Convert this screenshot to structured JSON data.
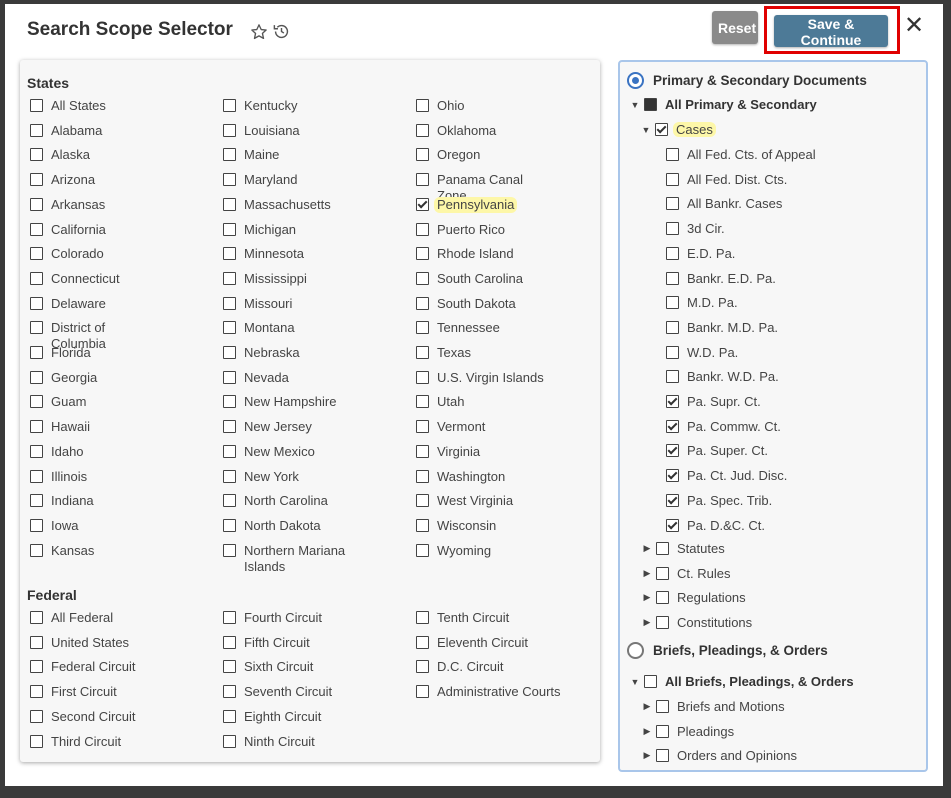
{
  "header": {
    "title": "Search Scope Selector",
    "star_icon": "star-icon",
    "history_icon": "history-icon",
    "reset_label": "Reset",
    "save_label": "Save & Continue",
    "close_label": "✕"
  },
  "states": {
    "heading": "States",
    "columns": [
      [
        {
          "label": "All States",
          "checked": false
        },
        {
          "label": "Alabama",
          "checked": false
        },
        {
          "label": "Alaska",
          "checked": false
        },
        {
          "label": "Arizona",
          "checked": false
        },
        {
          "label": "Arkansas",
          "checked": false
        },
        {
          "label": "California",
          "checked": false
        },
        {
          "label": "Colorado",
          "checked": false
        },
        {
          "label": "Connecticut",
          "checked": false
        },
        {
          "label": "Delaware",
          "checked": false
        },
        {
          "label": "District of Columbia",
          "checked": false
        },
        {
          "label": "Florida",
          "checked": false
        },
        {
          "label": "Georgia",
          "checked": false
        },
        {
          "label": "Guam",
          "checked": false
        },
        {
          "label": "Hawaii",
          "checked": false
        },
        {
          "label": "Idaho",
          "checked": false
        },
        {
          "label": "Illinois",
          "checked": false
        },
        {
          "label": "Indiana",
          "checked": false
        },
        {
          "label": "Iowa",
          "checked": false
        },
        {
          "label": "Kansas",
          "checked": false
        }
      ],
      [
        {
          "label": "Kentucky",
          "checked": false
        },
        {
          "label": "Louisiana",
          "checked": false
        },
        {
          "label": "Maine",
          "checked": false
        },
        {
          "label": "Maryland",
          "checked": false
        },
        {
          "label": "Massachusetts",
          "checked": false
        },
        {
          "label": "Michigan",
          "checked": false
        },
        {
          "label": "Minnesota",
          "checked": false
        },
        {
          "label": "Mississippi",
          "checked": false
        },
        {
          "label": "Missouri",
          "checked": false
        },
        {
          "label": "Montana",
          "checked": false
        },
        {
          "label": "Nebraska",
          "checked": false
        },
        {
          "label": "Nevada",
          "checked": false
        },
        {
          "label": "New Hampshire",
          "checked": false
        },
        {
          "label": "New Jersey",
          "checked": false
        },
        {
          "label": "New Mexico",
          "checked": false
        },
        {
          "label": "New York",
          "checked": false
        },
        {
          "label": "North Carolina",
          "checked": false
        },
        {
          "label": "North Dakota",
          "checked": false
        },
        {
          "label": "Northern Mariana Islands",
          "checked": false
        }
      ],
      [
        {
          "label": "Ohio",
          "checked": false
        },
        {
          "label": "Oklahoma",
          "checked": false
        },
        {
          "label": "Oregon",
          "checked": false
        },
        {
          "label": "Panama Canal Zone",
          "checked": false
        },
        {
          "label": "Pennsylvania",
          "checked": true,
          "highlight": true
        },
        {
          "label": "Puerto Rico",
          "checked": false
        },
        {
          "label": "Rhode Island",
          "checked": false
        },
        {
          "label": "South Carolina",
          "checked": false
        },
        {
          "label": "South Dakota",
          "checked": false
        },
        {
          "label": "Tennessee",
          "checked": false
        },
        {
          "label": "Texas",
          "checked": false
        },
        {
          "label": "U.S. Virgin Islands",
          "checked": false
        },
        {
          "label": "Utah",
          "checked": false
        },
        {
          "label": "Vermont",
          "checked": false
        },
        {
          "label": "Virginia",
          "checked": false
        },
        {
          "label": "Washington",
          "checked": false
        },
        {
          "label": "West Virginia",
          "checked": false
        },
        {
          "label": "Wisconsin",
          "checked": false
        },
        {
          "label": "Wyoming",
          "checked": false
        }
      ]
    ]
  },
  "federal": {
    "heading": "Federal",
    "columns": [
      [
        {
          "label": "All Federal",
          "checked": false
        },
        {
          "label": "United States",
          "checked": false
        },
        {
          "label": "Federal Circuit",
          "checked": false
        },
        {
          "label": "First Circuit",
          "checked": false
        },
        {
          "label": "Second Circuit",
          "checked": false
        },
        {
          "label": "Third Circuit",
          "checked": false
        }
      ],
      [
        {
          "label": "Fourth Circuit",
          "checked": false
        },
        {
          "label": "Fifth Circuit",
          "checked": false
        },
        {
          "label": "Sixth Circuit",
          "checked": false
        },
        {
          "label": "Seventh Circuit",
          "checked": false
        },
        {
          "label": "Eighth Circuit",
          "checked": false
        },
        {
          "label": "Ninth Circuit",
          "checked": false
        }
      ],
      [
        {
          "label": "Tenth Circuit",
          "checked": false
        },
        {
          "label": "Eleventh Circuit",
          "checked": false
        },
        {
          "label": "D.C. Circuit",
          "checked": false
        },
        {
          "label": "Administrative Courts",
          "checked": false
        }
      ]
    ]
  },
  "doc_types": {
    "primary_radio": {
      "label": "Primary & Secondary Documents",
      "selected": true
    },
    "all_primary": {
      "label": "All Primary & Secondary",
      "state": "partial",
      "expanded": true
    },
    "cases": {
      "label": "Cases",
      "checked": true,
      "expanded": true,
      "highlight": true
    },
    "case_items": [
      {
        "label": "All Fed. Cts. of Appeal",
        "checked": false
      },
      {
        "label": "All Fed. Dist. Cts.",
        "checked": false
      },
      {
        "label": "All Bankr. Cases",
        "checked": false
      },
      {
        "label": "3d Cir.",
        "checked": false
      },
      {
        "label": "E.D. Pa.",
        "checked": false
      },
      {
        "label": "Bankr. E.D. Pa.",
        "checked": false
      },
      {
        "label": "M.D. Pa.",
        "checked": false
      },
      {
        "label": "Bankr. M.D. Pa.",
        "checked": false
      },
      {
        "label": "W.D. Pa.",
        "checked": false
      },
      {
        "label": "Bankr. W.D. Pa.",
        "checked": false
      },
      {
        "label": "Pa. Supr. Ct.",
        "checked": true
      },
      {
        "label": "Pa. Commw. Ct.",
        "checked": true
      },
      {
        "label": "Pa. Super. Ct.",
        "checked": true
      },
      {
        "label": "Pa. Ct. Jud. Disc.",
        "checked": true
      },
      {
        "label": "Pa. Spec. Trib.",
        "checked": true
      },
      {
        "label": "Pa. D.&C. Ct.",
        "checked": true
      }
    ],
    "other_primary": [
      {
        "label": "Statutes",
        "checked": false
      },
      {
        "label": "Ct. Rules",
        "checked": false
      },
      {
        "label": "Regulations",
        "checked": false
      },
      {
        "label": "Constitutions",
        "checked": false
      }
    ],
    "briefs_radio": {
      "label": "Briefs, Pleadings, & Orders",
      "selected": false
    },
    "all_briefs": {
      "label": "All Briefs, Pleadings, & Orders",
      "checked": false,
      "expanded": true
    },
    "brief_items": [
      {
        "label": "Briefs and Motions",
        "checked": false
      },
      {
        "label": "Pleadings",
        "checked": false
      },
      {
        "label": "Orders and Opinions",
        "checked": false
      }
    ]
  }
}
